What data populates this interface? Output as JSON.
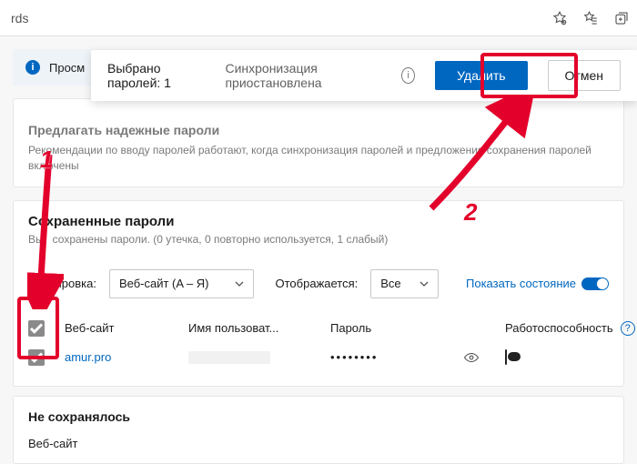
{
  "addr": {
    "fragment": "rds"
  },
  "notice": {
    "text_fragment": "Просм"
  },
  "floating_bar": {
    "selected": "Выбрано паролей: 1",
    "sync": "Синхронизация приостановлена",
    "delete": "Удалить",
    "cancel": "Отмен"
  },
  "recommend": {
    "title": "Предлагать надежные пароли",
    "desc": "Рекомендации по вводу паролей работают, когда синхронизация паролей и предложения сохранения паролей включены"
  },
  "saved": {
    "title": "Сохраненные пароли",
    "desc_prefix": "Вы",
    "desc_rest": "сохранены пароли. (0 утечка, 0 повторно используется, 1 слабый)",
    "sort_label_fragment": "тировка:",
    "sort_value": "Веб-сайт (A – Я)",
    "display_label": "Отображается:",
    "display_value": "Все",
    "show_state": "Показать состояние",
    "headers": {
      "site": "Веб-сайт",
      "user": "Имя пользоват...",
      "password": "Пароль",
      "health": "Работоспособность"
    },
    "rows": [
      {
        "site": "amur.pro",
        "password_mask": "••••••••"
      }
    ]
  },
  "nosave": {
    "title": "Не сохранялось",
    "sub": "Веб-сайт"
  },
  "anno": {
    "n1": "1",
    "n2": "2"
  }
}
